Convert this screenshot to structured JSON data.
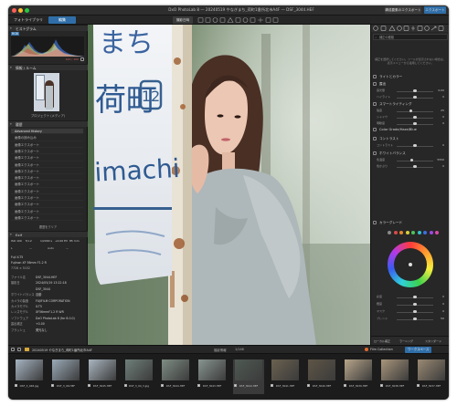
{
  "window": {
    "title": "DxO PhotoLab 8 — 20240519 やなぎまち_荷町1番所北市A4F — DSF_3044.HEF",
    "traffic_colors": [
      "#ff5f57",
      "#febc2e",
      "#28c840"
    ]
  },
  "toolbar": {
    "selected_album_label": "撮影日時",
    "export_button": "構成要素のエクスポート",
    "compare_button": "エクスポート"
  },
  "tabs": {
    "library": "フォトライブラリ",
    "customize": "編集"
  },
  "left_panel": {
    "histogram_title": "ヒストグラム",
    "hist_left_label": "RGB",
    "hist_right_label": "100 / 100",
    "info_section": "情報 / ルーム",
    "info_caption": "プロジェクト (メディア)",
    "history_section": "履歴",
    "history_items": [
      "Advanced History",
      "画像の読み込み",
      "画像エクスポート",
      "画像エクスポート",
      "画像エクスポート",
      "画像エクスポート",
      "画像エクスポート",
      "画像エクスポート",
      "画像エクスポート",
      "画像エクスポート",
      "画像エクスポート",
      "画像エクスポート",
      "画像エクスポート",
      "画像エクスポート"
    ],
    "history_footer": "履歴をクリア",
    "exif_section": "Exif",
    "exif_top": [
      "ISO 100",
      "f/1.2",
      "1/2000 s",
      "+0.00 EV",
      "85 mm"
    ],
    "exif_mode": [
      "L",
      "—",
      "Auto",
      "—"
    ],
    "exif_lens": "Fuji X-T5",
    "exif_lens2": "Fujinon XF 56mm F1.2 R",
    "exif_size": "7728 × 5152",
    "exif_rows": [
      {
        "k": "ファイル名",
        "v": "DSF_3044.HEF"
      },
      {
        "k": "撮影日",
        "v": "2024/05/19 13:22:18"
      },
      {
        "k": "",
        "v": "DSF_3044"
      },
      {
        "k": "ホワイトバランス",
        "v": "自動"
      },
      {
        "k": "カメラの製造",
        "v": "FUJIFILM CORPORATION"
      },
      {
        "k": "カメラモデル",
        "v": "X-T5"
      },
      {
        "k": "レンズモデル",
        "v": "XF56mmF1.2 R WR"
      },
      {
        "k": "ソフトウェア",
        "v": "DxO PhotoLab 8 (for 8.0.0)"
      },
      {
        "k": "露出補正",
        "v": "+0.00"
      },
      {
        "k": "フラッシュ",
        "v": "発光なし"
      }
    ]
  },
  "right_panel": {
    "tabs_label": "補正の種類",
    "info_text": "補正を選択してください。ツールが表示されない場合は、表示メニューから適用してください。",
    "sections": [
      "ライトとカラー",
      "露出",
      "スマートライティング",
      "Color Grade/Haze/Blue",
      "コントラスト",
      "ホワイトバランス",
      "カラーグレード"
    ],
    "sliders": [
      {
        "label": "露光量",
        "val": "0.00",
        "pos": 0.5
      },
      {
        "label": "ハイライト",
        "val": "0",
        "pos": 0.5
      },
      {
        "label": "強度",
        "val": "25",
        "pos": 0.38
      },
      {
        "label": "シャドウ",
        "val": "0",
        "pos": 0.5
      },
      {
        "label": "明瞭度",
        "val": "0",
        "pos": 0.5
      },
      {
        "label": "コントラスト",
        "val": "0",
        "pos": 0.5
      },
      {
        "label": "色温度",
        "val": "5550",
        "pos": 0.42
      },
      {
        "label": "色かぶり",
        "val": "0",
        "pos": 0.5
      },
      {
        "label": "彩度",
        "val": "0",
        "pos": 0.5
      },
      {
        "label": "輝度",
        "val": "0",
        "pos": 0.5
      },
      {
        "label": "マスク",
        "val": "0",
        "pos": 0.5
      },
      {
        "label": "ブレンド",
        "val": "50",
        "pos": 0.5
      }
    ],
    "bottom_tools": [
      "ローカル補正",
      "ラーニング",
      "スタンダード"
    ]
  },
  "center": {
    "sign_lines": [
      "まち",
      "荷町",
      "imachi"
    ],
    "sign_badge": "12"
  },
  "filmstrip_bar": {
    "path": "20240519 やなぎまち_荷町1番所北市A4F",
    "count": "1/146",
    "center_label": "撮影情報",
    "presets_label": "フィルタ",
    "collection_label": "Film Collection",
    "workspace_label": "ワークスペース"
  },
  "filmstrip": [
    {
      "name": "DSF_3_048.jpg",
      "tone": "#a6b4c2"
    },
    {
      "name": "DSF_3_06.HEF",
      "tone": "#9aaab7"
    },
    {
      "name": "DSF_3045.HEF",
      "tone": "#aab6c0"
    },
    {
      "name": "DSF_3_04_3.jpg",
      "tone": "#6f7f7a"
    },
    {
      "name": "DSF_3044.HEF",
      "tone": "#7e8d84"
    },
    {
      "name": "DSF_3043.HEF",
      "tone": "#889590"
    },
    {
      "name": "DSF_3044.HEF",
      "tone": "#4f5a53"
    },
    {
      "name": "DSF_3041.HEF",
      "tone": "#6a6150"
    },
    {
      "name": "DSF_3040.HEF",
      "tone": "#5e5546"
    },
    {
      "name": "DSF_3039.HEF",
      "tone": "#b7a58a"
    },
    {
      "name": "DSF_3038.HEF",
      "tone": "#a8957b"
    },
    {
      "name": "DSF_3037.HEF",
      "tone": "#9a8a73"
    }
  ]
}
